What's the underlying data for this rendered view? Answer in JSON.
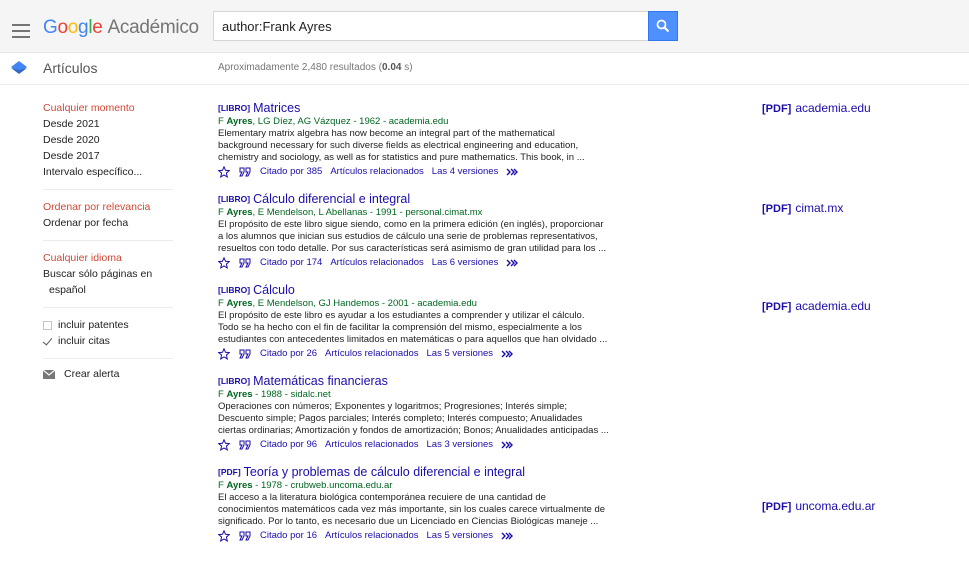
{
  "header": {
    "logo_parts": [
      "G",
      "o",
      "o",
      "g",
      "l",
      "e"
    ],
    "product": "Académico",
    "search_value": "author:Frank Ayres"
  },
  "subheader": {
    "section": "Artículos",
    "count_prefix": "Aproximadamente 2,480 resultados (",
    "count_time": "0.04",
    "count_suffix": " s)"
  },
  "sidebar": {
    "time_filters": [
      "Cualquier momento",
      "Desde 2021",
      "Desde 2020",
      "Desde 2017",
      "Intervalo específico..."
    ],
    "sort_options": [
      "Ordenar por relevancia",
      "Ordenar por fecha"
    ],
    "language": [
      "Cualquier idioma",
      "Buscar sólo páginas en",
      "español"
    ],
    "include_patents": "incluir patentes",
    "include_citations": "incluir citas",
    "create_alert": "Crear alerta"
  },
  "results": [
    {
      "tag": "[LIBRO]",
      "title": "Matrices",
      "authors_lead": "F ",
      "authors_bold": "Ayres",
      "authors_rest": ", LG Díez, AG Vázquez - 1962 - academia.edu",
      "snippet": [
        "Elementary matrix algebra has now become an integral part of the mathematical",
        "background necessary for such diverse fields as electrical engineering and education,",
        "chemistry and sociology, as well as for statistics and pure mathematics. This book, in ..."
      ],
      "cited": "Citado por 385",
      "related": "Artículos relacionados",
      "versions": "Las 4 versiones",
      "side_tag": "[PDF]",
      "side_domain": "academia.edu"
    },
    {
      "tag": "[LIBRO]",
      "title": "Cálculo diferencial e integral",
      "authors_lead": "F ",
      "authors_bold": "Ayres",
      "authors_rest": ", E Mendelson, L Abellanas - 1991 - personal.cimat.mx",
      "snippet": [
        "El propósito de este libro sigue siendo, como en la primera edición (en inglés), proporcionar",
        "a los alumnos que inician sus estudios de cálculo una serie de problemas representativos,",
        "resueltos con todo detalle. Por sus características será asimismo de gran utilidad para los ..."
      ],
      "cited": "Citado por 174",
      "related": "Artículos relacionados",
      "versions": "Las 6 versiones",
      "side_tag": "[PDF]",
      "side_domain": "cimat.mx"
    },
    {
      "tag": "[LIBRO]",
      "title": "Cálculo",
      "authors_lead": "F ",
      "authors_bold": "Ayres",
      "authors_rest": ", E Mendelson, GJ Handemos - 2001 - academia.edu",
      "snippet": [
        "El propósito de este libro es ayudar a los estudiantes a comprender y utilizar el cálculo.",
        "Todo se ha hecho con el fin de facilitar la comprensión del mismo, especialmente a los",
        "estudiantes con antecedentes limitados en matemáticas o para aquellos que han olvidado ..."
      ],
      "cited": "Citado por 26",
      "related": "Artículos relacionados",
      "versions": "Las 5 versiones",
      "side_tag": "[PDF]",
      "side_domain": "academia.edu"
    },
    {
      "tag": "[LIBRO]",
      "title": "Matemáticas financieras",
      "authors_lead": "F ",
      "authors_bold": "Ayres",
      "authors_rest": " - 1988 - sidalc.net",
      "snippet": [
        "Operaciones con números; Exponentes y logaritmos; Progresiones; Interés simple;",
        "Descuento simple; Pagos parciales; Interés completo; Interés compuesto; Anualidades",
        "ciertas ordinarias; Amortización y fondos de amortización; Bonos; Anualidades anticipadas ..."
      ],
      "cited": "Citado por 96",
      "related": "Artículos relacionados",
      "versions": "Las 3 versiones",
      "side_tag": "",
      "side_domain": ""
    },
    {
      "tag": "[PDF]",
      "title": "Teoría y problemas de cálculo diferencial e integral",
      "authors_lead": "F ",
      "authors_bold": "Ayres",
      "authors_rest": " - 1978 - crubweb.uncoma.edu.ar",
      "snippet": [
        "El acceso a la literatura biológica contemporánea recuiere de una cantidad de",
        "conocimientos matemáticos cada vez más importante, sin los cuales carece virtualmente de",
        "significado. Por lo tanto, es necesario due un Licenciado en Ciencias Biológicas maneje ..."
      ],
      "cited": "Citado por 16",
      "related": "Artículos relacionados",
      "versions": "Las 5 versiones",
      "side_tag": "[PDF]",
      "side_domain": "uncoma.edu.ar"
    }
  ],
  "colors": {
    "link": "#1a0dab",
    "author": "#006621",
    "selected_filter": "#d14836",
    "search_button": "#4d90fe"
  },
  "icons": {
    "menu": "hamburger-menu-icon",
    "search": "magnifier-icon",
    "section": "articles-diamond-icon",
    "save": "star-icon",
    "cite": "quote-icon",
    "more": "double-chevron-icon",
    "alert": "mail-icon"
  }
}
